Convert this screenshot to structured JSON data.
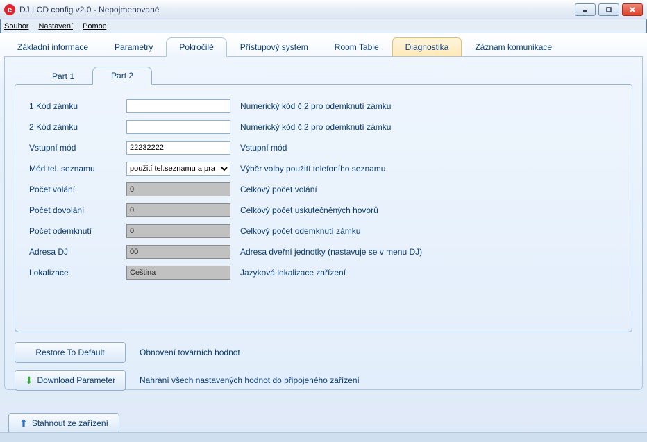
{
  "window": {
    "app_icon_letter": "e",
    "title": "DJ LCD config v2.0 - Nepojmenované"
  },
  "menu": {
    "file": "Soubor",
    "settings": "Nastavení",
    "help": "Pomoc"
  },
  "tabs": {
    "basic": "Základní informace",
    "params": "Parametry",
    "advanced": "Pokročilé",
    "access": "Přístupový systém",
    "room": "Room Table",
    "diag": "Diagnostika",
    "comm": "Záznam komunikace"
  },
  "subtabs": {
    "part1": "Part 1",
    "part2": "Part 2"
  },
  "fields": {
    "lock1": {
      "label": "1 Kód zámku",
      "value": "",
      "desc": "Numerický kód č.2 pro odemknutí zámku"
    },
    "lock2": {
      "label": "2 Kód zámku",
      "value": "",
      "desc": "Numerický kód č.2 pro odemknutí zámku"
    },
    "inputmode": {
      "label": "Vstupní mód",
      "value": "22232222",
      "desc": "Vstupní mód"
    },
    "phonebook": {
      "label": "Mód tel. seznamu",
      "selected": "použití tel.seznamu a pra",
      "desc": "Výběr volby použití telefoního seznamu"
    },
    "calls": {
      "label": "Počet volání",
      "value": "0",
      "desc": "Celkový počet volání"
    },
    "connected": {
      "label": "Počet dovolání",
      "value": "0",
      "desc": "Celkový počet uskutečněných hovorů"
    },
    "unlocks": {
      "label": "Počet odemknutí",
      "value": "0",
      "desc": "Celkový počet odemknutí zámku"
    },
    "address": {
      "label": "Adresa DJ",
      "value": "00",
      "desc": "Adresa dveřní jednotky (nastavuje se v menu DJ)"
    },
    "locale": {
      "label": "Lokalizace",
      "value": "Čeština",
      "desc": "Jazyková lokalizace zařízení"
    }
  },
  "buttons": {
    "restore": {
      "label": "Restore To Default",
      "desc": "Obnovení továrních hodnot"
    },
    "download": {
      "label": "Download Parameter",
      "desc": "Nahrání všech nastavených hodnot do připojeného zařízení"
    },
    "upload": {
      "label": "Stáhnout ze zařízení"
    }
  }
}
